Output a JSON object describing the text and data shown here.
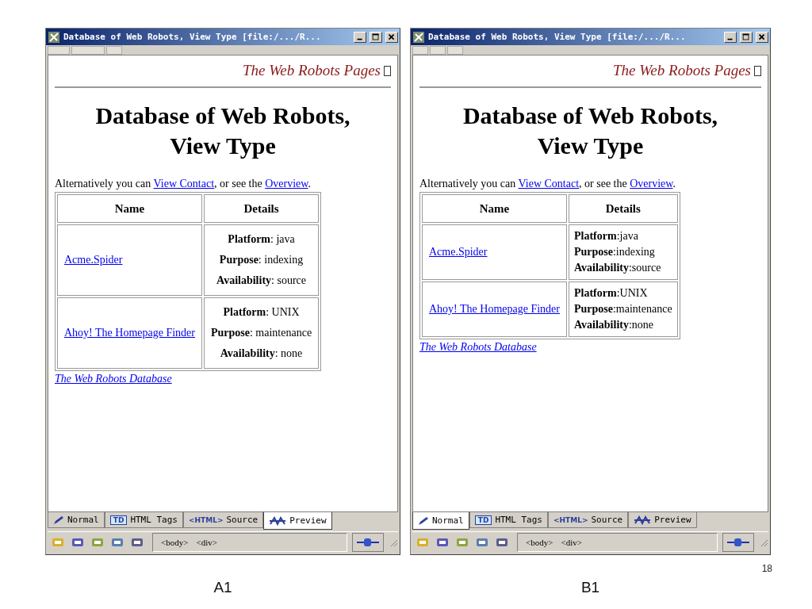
{
  "windows": [
    {
      "caption": "A1",
      "title": "Database of Web Robots, View Type [file:/.../R...",
      "header_link": "The Web Robots Pages",
      "heading": "Database of Web Robots, View Type",
      "intro": {
        "before": "Alternatively you can ",
        "link_1": "View Contact",
        "middle": ", or see the ",
        "link_2": "Overview",
        "after": "."
      },
      "table": {
        "columns": [
          "Name",
          "Details"
        ],
        "kind": "centered",
        "rows": [
          {
            "name": "Acme.Spider",
            "details": [
              "**Platform**: java",
              "**Purpose**: indexing",
              "**Availability**: source"
            ]
          },
          {
            "name": "Ahoy! The Homepage Finder",
            "details": [
              "**Platform**: UNIX",
              "**Purpose**: maintenance",
              "**Availability**: none"
            ]
          }
        ]
      },
      "footer_link": "The Web Robots Database",
      "tabs": [
        {
          "kind": "pen",
          "label": "Normal",
          "selected": false
        },
        {
          "kind": "tags",
          "icon_text": "TD",
          "label": "HTML Tags",
          "selected": false
        },
        {
          "kind": "source",
          "icon_text": "<HTML>",
          "label": "Source",
          "selected": false
        },
        {
          "kind": "preview",
          "label": "Preview",
          "selected": true
        }
      ],
      "tag_path": [
        "<body>",
        "<div>"
      ]
    },
    {
      "caption": "B1",
      "title": "Database of Web Robots, View Type [file:/.../R...",
      "header_link": "The Web Robots Pages",
      "heading": "Database of Web Robots, View Type",
      "intro": {
        "before": "Alternatively you can ",
        "link_1": "View Contact",
        "middle": ", or see the ",
        "link_2": "Overview",
        "after": "."
      },
      "table": {
        "columns": [
          "Name",
          "Details"
        ],
        "kind": "left",
        "rows": [
          {
            "name": "Acme.Spider",
            "details": [
              "**Platform**:java",
              "**Purpose**:indexing",
              "**Availability**:source"
            ]
          },
          {
            "name": "Ahoy! The Homepage Finder",
            "details": [
              "**Platform**:UNIX",
              "**Purpose**:maintenance",
              "**Availability**:none"
            ]
          }
        ]
      },
      "footer_link": "The Web Robots Database",
      "tabs": [
        {
          "kind": "pen",
          "label": "Normal",
          "selected": true
        },
        {
          "kind": "tags",
          "icon_text": "TD",
          "label": "HTML Tags",
          "selected": false
        },
        {
          "kind": "source",
          "icon_text": "<HTML>",
          "label": "Source",
          "selected": false
        },
        {
          "kind": "preview",
          "label": "Preview",
          "selected": false
        }
      ],
      "tag_path": [
        "<body>",
        "<div>"
      ]
    }
  ],
  "slide_number": "18"
}
